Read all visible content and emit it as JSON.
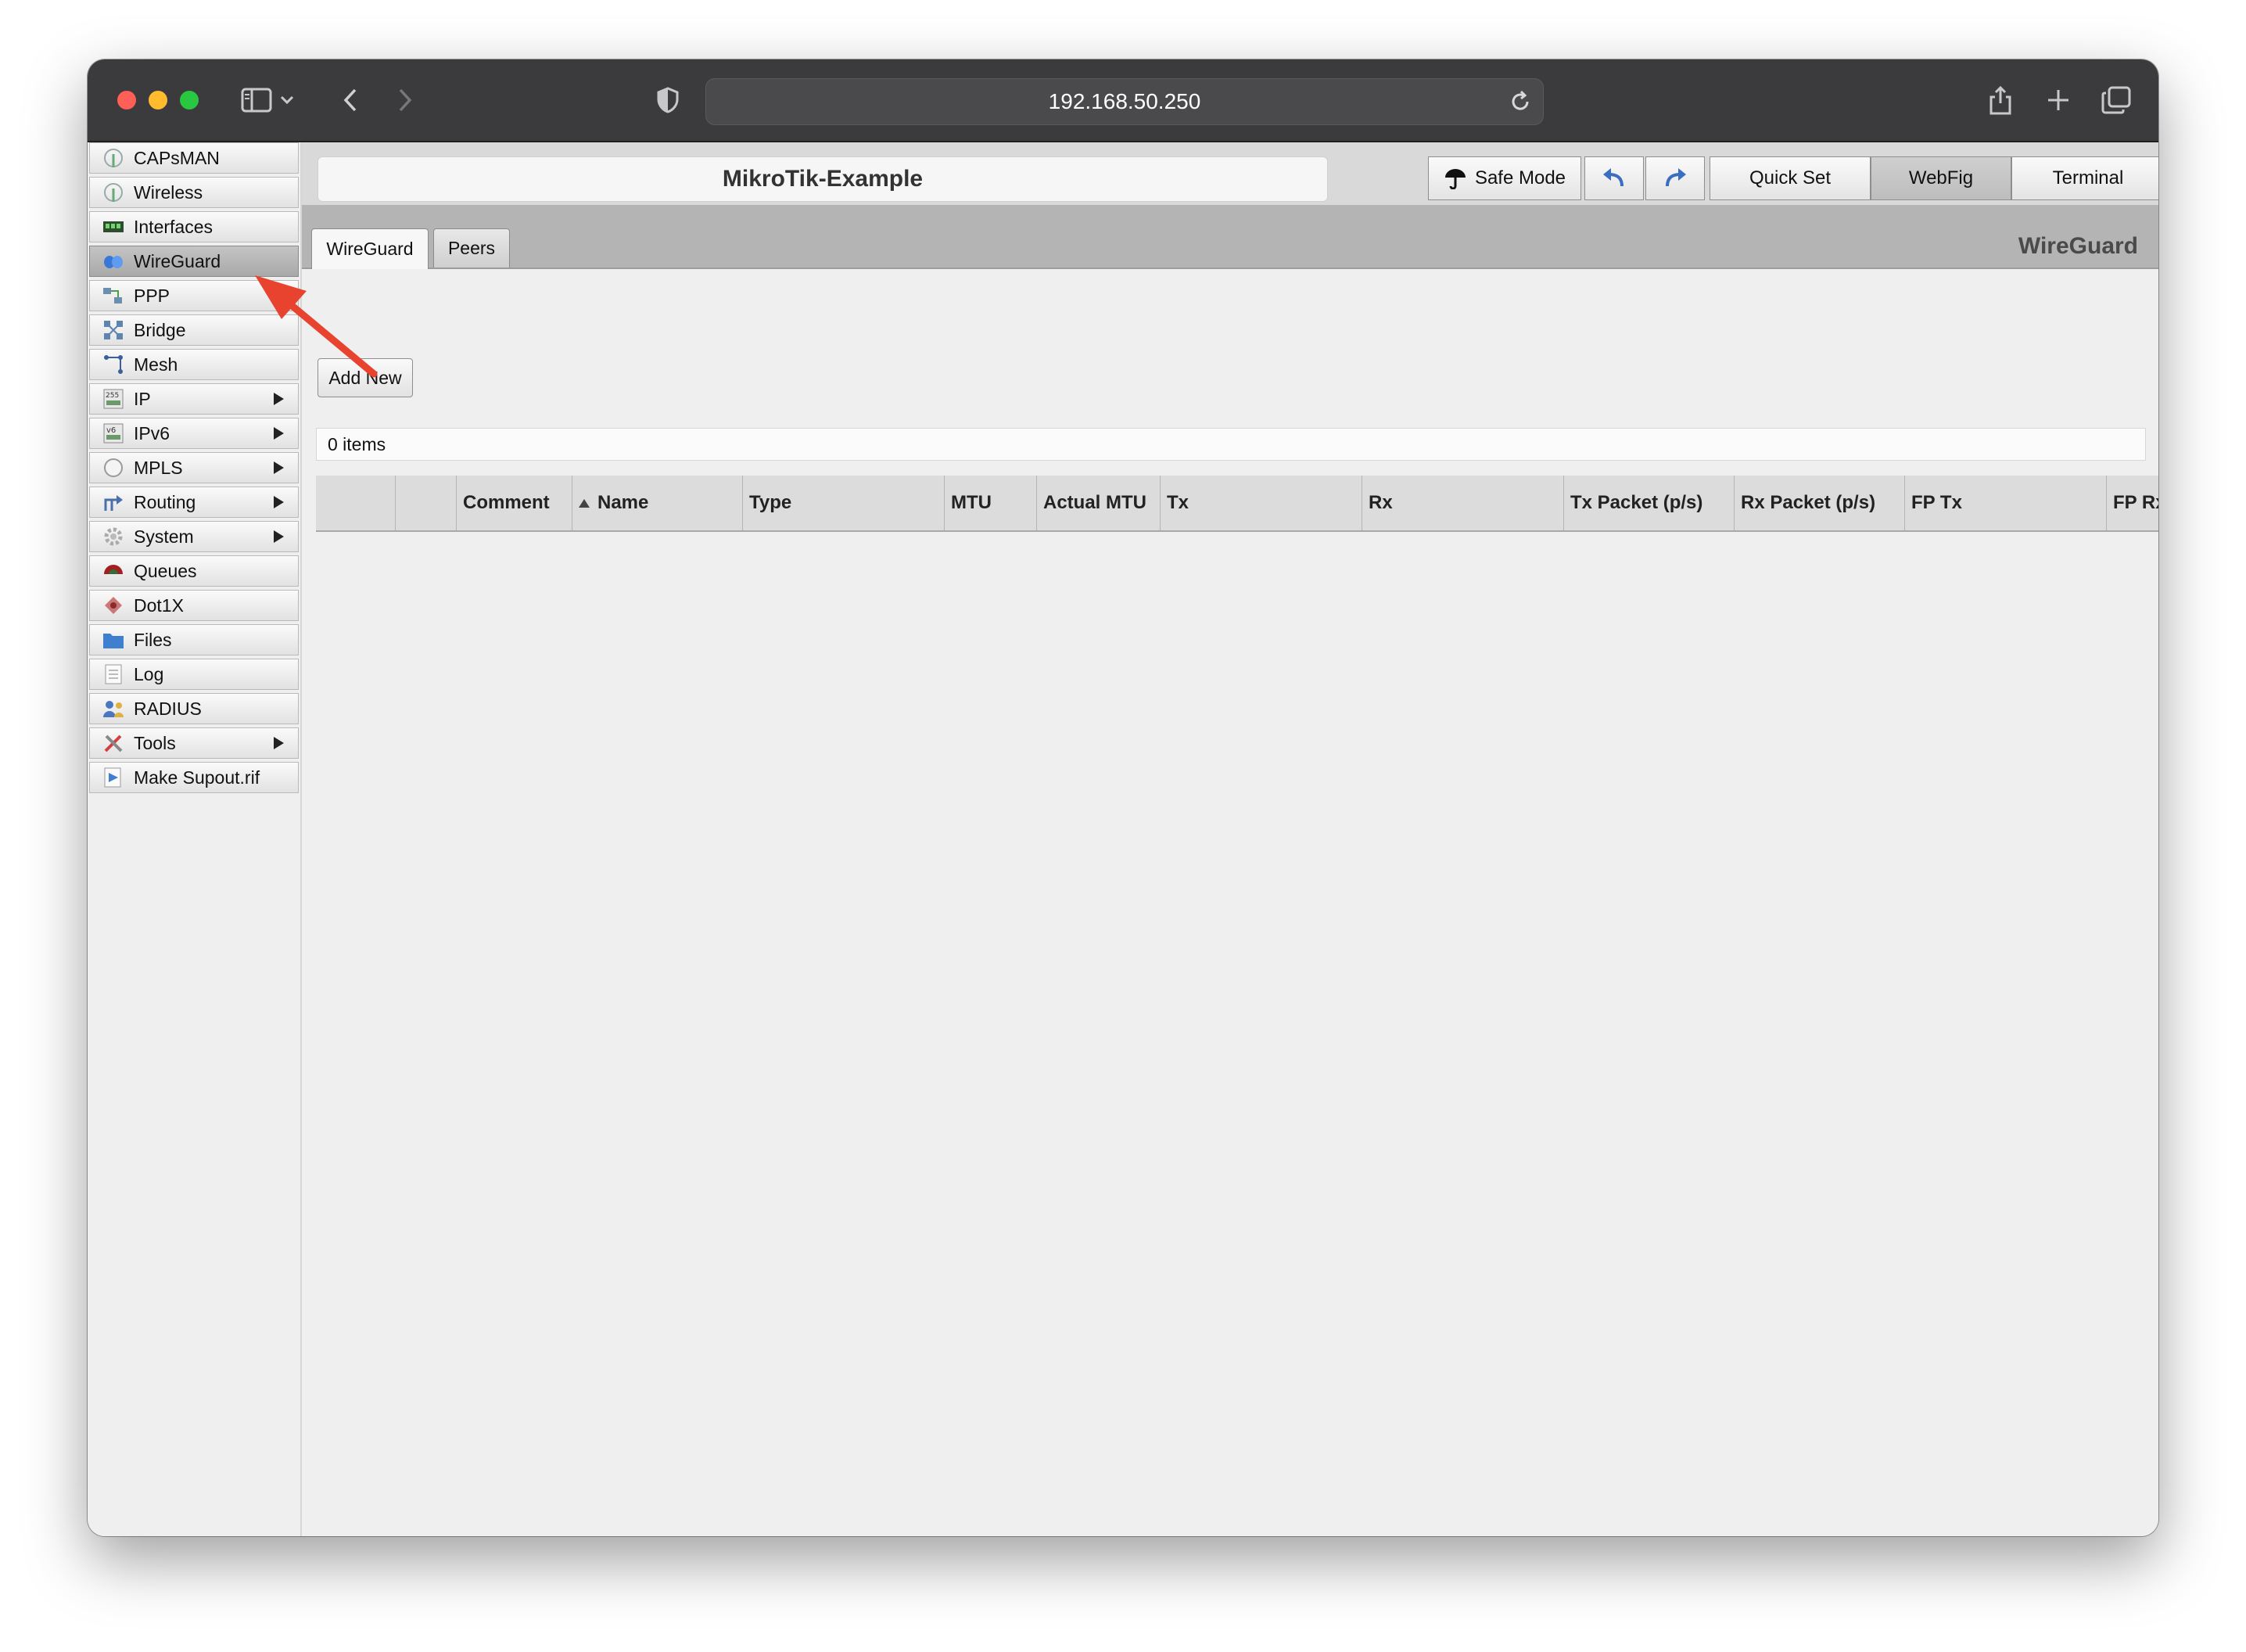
{
  "browser": {
    "url": "192.168.50.250"
  },
  "sidebar": {
    "items": [
      {
        "label": "CAPsMAN",
        "icon": "antenna-icon",
        "submenu": false
      },
      {
        "label": "Wireless",
        "icon": "antenna-icon",
        "submenu": false
      },
      {
        "label": "Interfaces",
        "icon": "interface-card-icon",
        "submenu": false
      },
      {
        "label": "WireGuard",
        "icon": "wireguard-icon",
        "submenu": false,
        "active": true
      },
      {
        "label": "PPP",
        "icon": "ppp-icon",
        "submenu": false
      },
      {
        "label": "Bridge",
        "icon": "bridge-icon",
        "submenu": false
      },
      {
        "label": "Mesh",
        "icon": "mesh-icon",
        "submenu": false
      },
      {
        "label": "IP",
        "icon": "ip-icon",
        "submenu": true
      },
      {
        "label": "IPv6",
        "icon": "ipv6-icon",
        "submenu": true
      },
      {
        "label": "MPLS",
        "icon": "mpls-icon",
        "submenu": true
      },
      {
        "label": "Routing",
        "icon": "routing-icon",
        "submenu": true
      },
      {
        "label": "System",
        "icon": "system-gear-icon",
        "submenu": true
      },
      {
        "label": "Queues",
        "icon": "queues-icon",
        "submenu": false
      },
      {
        "label": "Dot1X",
        "icon": "dot1x-icon",
        "submenu": false
      },
      {
        "label": "Files",
        "icon": "folder-icon",
        "submenu": false
      },
      {
        "label": "Log",
        "icon": "log-icon",
        "submenu": false
      },
      {
        "label": "RADIUS",
        "icon": "radius-users-icon",
        "submenu": false
      },
      {
        "label": "Tools",
        "icon": "tools-icon",
        "submenu": true
      },
      {
        "label": "Make Supout.rif",
        "icon": "supout-icon",
        "submenu": false
      }
    ]
  },
  "header": {
    "router_name": "MikroTik-Example",
    "safe_mode": "Safe Mode",
    "quick_set": "Quick Set",
    "webfig": "WebFig",
    "terminal": "Terminal"
  },
  "tabs": [
    {
      "label": "WireGuard",
      "active": true
    },
    {
      "label": "Peers",
      "active": false
    }
  ],
  "section_title": "WireGuard",
  "add_new": "Add New",
  "items_count": "0 items",
  "table": {
    "columns": [
      "",
      "",
      "Comment",
      "Name",
      "Type",
      "MTU",
      "Actual MTU",
      "Tx",
      "Rx",
      "Tx Packet (p/s)",
      "Rx Packet (p/s)",
      "FP Tx",
      "FP Rx"
    ],
    "sorted_column": "Name",
    "rows": []
  },
  "colors": {
    "annotation_arrow": "#e8432f",
    "titlebar": "#3b3b3d"
  }
}
